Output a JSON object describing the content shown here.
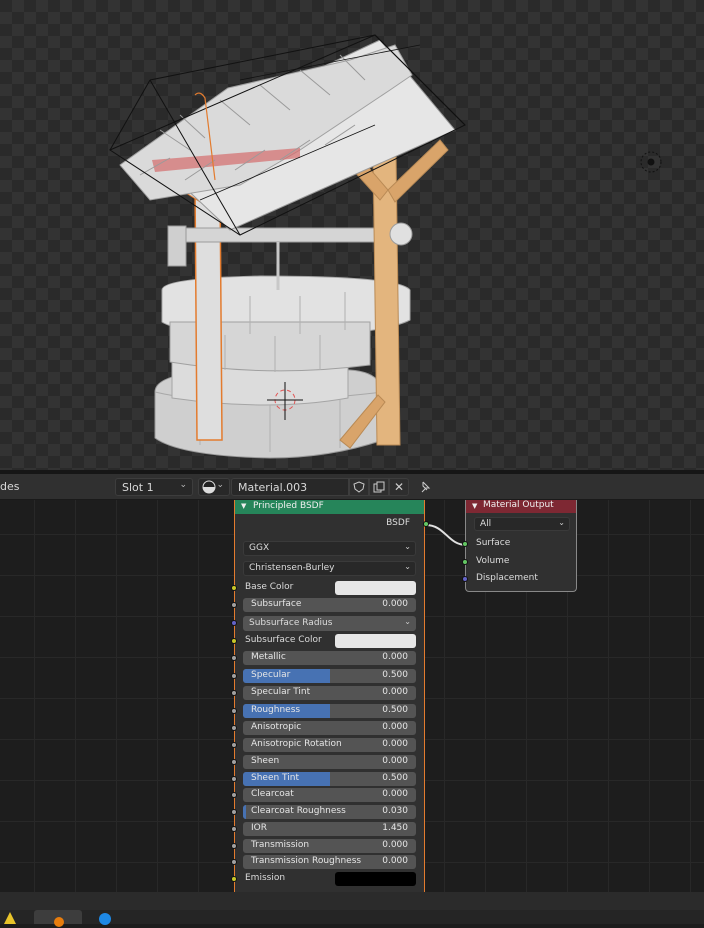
{
  "header": {
    "editor_name_fragment": "des",
    "slot": "Slot 1",
    "material_name": "Material.003"
  },
  "bsdf_node": {
    "title": "Principled BSDF",
    "output_label": "BSDF",
    "distribution": "GGX",
    "subsurface_method": "Christensen-Burley",
    "base_color_label": "Base Color",
    "base_color": "#e6e6e6",
    "subsurface": {
      "label": "Subsurface",
      "value": "0.000",
      "fraction": 0
    },
    "subsurface_radius_label": "Subsurface Radius",
    "subsurface_color_label": "Subsurface Color",
    "subsurface_color": "#e6e6e6",
    "metallic": {
      "label": "Metallic",
      "value": "0.000",
      "fraction": 0
    },
    "specular": {
      "label": "Specular",
      "value": "0.500",
      "fraction": 0.5
    },
    "specular_tint": {
      "label": "Specular Tint",
      "value": "0.000",
      "fraction": 0
    },
    "roughness": {
      "label": "Roughness",
      "value": "0.500",
      "fraction": 0.5
    },
    "anisotropic": {
      "label": "Anisotropic",
      "value": "0.000",
      "fraction": 0
    },
    "anisotropic_rotation": {
      "label": "Anisotropic Rotation",
      "value": "0.000",
      "fraction": 0
    },
    "sheen": {
      "label": "Sheen",
      "value": "0.000",
      "fraction": 0
    },
    "sheen_tint": {
      "label": "Sheen Tint",
      "value": "0.500",
      "fraction": 0.5
    },
    "clearcoat": {
      "label": "Clearcoat",
      "value": "0.000",
      "fraction": 0
    },
    "clearcoat_roughness": {
      "label": "Clearcoat Roughness",
      "value": "0.030",
      "fraction": 0.03
    },
    "ior": {
      "label": "IOR",
      "value": "1.450"
    },
    "transmission": {
      "label": "Transmission",
      "value": "0.000",
      "fraction": 0
    },
    "transmission_roughness": {
      "label": "Transmission Roughness",
      "value": "0.000",
      "fraction": 0
    },
    "emission_label": "Emission",
    "emission_color": "#000000"
  },
  "output_node": {
    "title": "Material Output",
    "target": "All",
    "surface_label": "Surface",
    "volume_label": "Volume",
    "displacement_label": "Displacement"
  },
  "colors": {
    "selection_outline": "#e37b2e",
    "shader_header": "#26855a",
    "output_header": "#7e2833",
    "slider_fill": "#4772b3",
    "socket_shader": "#63c763",
    "socket_color": "#c7c729",
    "socket_float": "#a1a1a1",
    "socket_vector": "#6363c7"
  }
}
